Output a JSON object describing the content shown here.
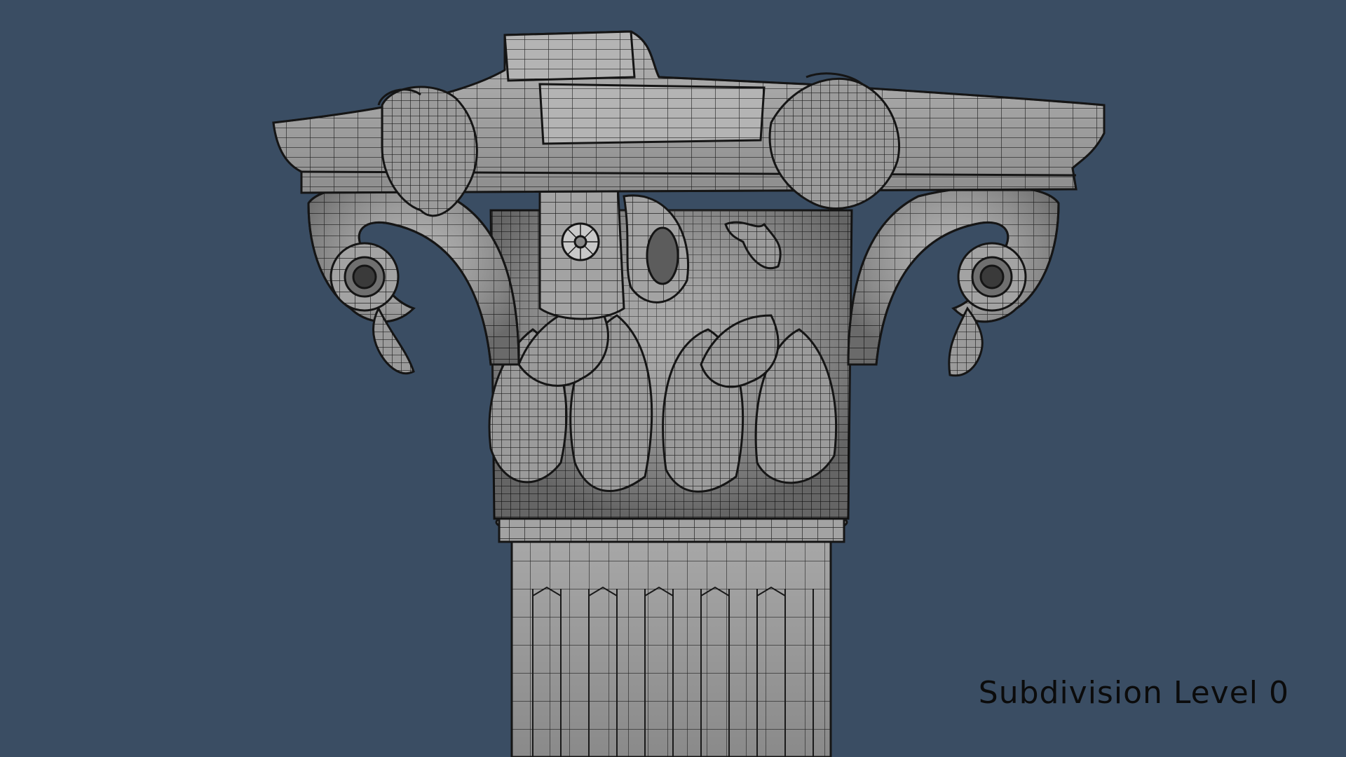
{
  "viewport": {
    "background_color": "#3a4d63",
    "model_color": "#9a9a9a",
    "wire_color": "#1e1e1e",
    "caption": "Subdivision Level 0"
  }
}
